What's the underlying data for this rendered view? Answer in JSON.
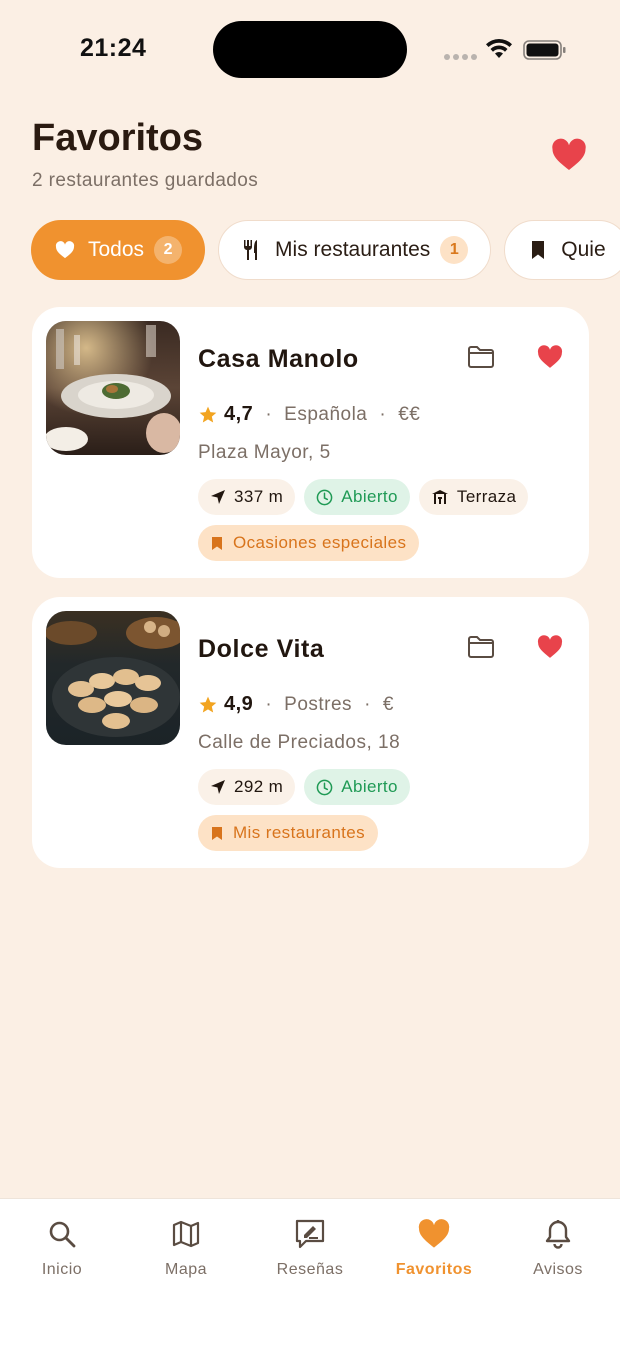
{
  "status_bar": {
    "time": "21:24"
  },
  "header": {
    "title": "Favoritos",
    "subtitle": "2 restaurantes guardados"
  },
  "filters": [
    {
      "label": "Todos",
      "count": "2",
      "icon": "heart-icon",
      "active": true
    },
    {
      "label": "Mis restaurantes",
      "count": "1",
      "icon": "fork-knife-icon",
      "active": false
    },
    {
      "label": "Quie",
      "icon": "bookmark-icon",
      "active": false
    }
  ],
  "restaurants": [
    {
      "name": "Casa Manolo",
      "rating": "4,7",
      "cuisine": "Española",
      "price": "€€",
      "address": "Plaza Mayor, 5",
      "distance": "337 m",
      "status": "Abierto",
      "feature": "Terraza",
      "collection": "Ocasiones especiales"
    },
    {
      "name": "Dolce Vita",
      "rating": "4,9",
      "cuisine": "Postres",
      "price": "€",
      "address": "Calle de Preciados, 18",
      "distance": "292 m",
      "status": "Abierto",
      "collection": "Mis restaurantes"
    }
  ],
  "bottom_nav": [
    {
      "label": "Inicio",
      "icon": "search-icon"
    },
    {
      "label": "Mapa",
      "icon": "map-icon"
    },
    {
      "label": "Reseñas",
      "icon": "review-icon"
    },
    {
      "label": "Favoritos",
      "icon": "heart-icon",
      "active": true
    },
    {
      "label": "Avisos",
      "icon": "bell-icon"
    }
  ],
  "colors": {
    "background": "#fbefe4",
    "accent": "#f0922f",
    "heart": "#e8434b",
    "open_green": "#1f9a55",
    "star": "#f2a420"
  }
}
